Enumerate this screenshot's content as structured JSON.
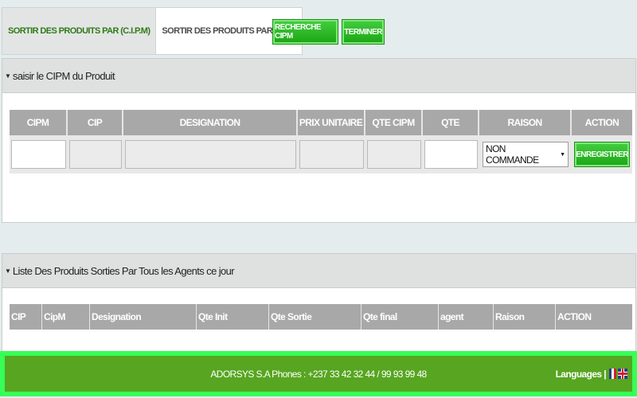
{
  "tabs": [
    {
      "label": "SORTIR DES PRODUITS PAR (C.I.P.M)",
      "active": true
    },
    {
      "label": "SORTIR DES PRODUITS PAR (C.I.P)",
      "active": false
    }
  ],
  "toolbar": {
    "recherche_label": "RECHERCHE CIPM",
    "terminer_label": "TERMINER"
  },
  "section1": {
    "title": "saisir le CIPM du Produit",
    "columns": [
      "CIPM",
      "CIP",
      "DESIGNATION",
      "PRIX UNITAIRE",
      "QTE CIPM",
      "QTE",
      "RAISON",
      "ACTION"
    ],
    "raison_selected": "NON COMMANDE",
    "enregistrer_label": "ENREGISTRER"
  },
  "section2": {
    "title": "Liste Des Produits Sorties Par Tous les Agents ce jour",
    "columns": [
      "CIP",
      "CipM",
      "Designation",
      "Qte Init",
      "Qte Sortie",
      "Qte final",
      "agent",
      "Raison",
      "ACTION"
    ]
  },
  "footer": {
    "text": "ADORSYS S.A Phones : +237 33 42 32 44 / 99 93 99 48",
    "languages_label": "Languages |"
  },
  "colors": {
    "accent_green": "#1ea817",
    "footer_green": "#57a520",
    "footer_border": "#36ff57",
    "header_gray": "#a8a8a8"
  },
  "icons": [
    "dropdown-arrow-icon",
    "collapse-caret-icon",
    "flag-fr-icon",
    "flag-uk-icon"
  ]
}
